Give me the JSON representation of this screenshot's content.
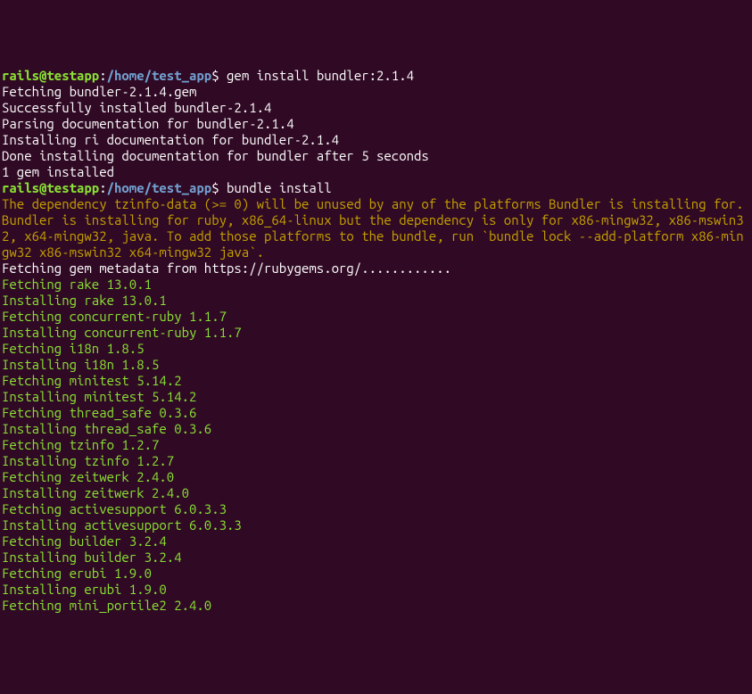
{
  "prompt1": {
    "user": "rails@testapp",
    "colon": ":",
    "path": "/home/test_app",
    "symbol": "$ ",
    "command": "gem install bundler:2.1.4"
  },
  "output1": {
    "line1": "Fetching bundler-2.1.4.gem",
    "line2": "Successfully installed bundler-2.1.4",
    "line3": "Parsing documentation for bundler-2.1.4",
    "line4": "Installing ri documentation for bundler-2.1.4",
    "line5": "Done installing documentation for bundler after 5 seconds",
    "line6": "1 gem installed"
  },
  "prompt2": {
    "user": "rails@testapp",
    "colon": ":",
    "path": "/home/test_app",
    "symbol": "$ ",
    "command": "bundle install"
  },
  "warning": "The dependency tzinfo-data (>= 0) will be unused by any of the platforms Bundler is installing for. Bundler is installing for ruby, x86_64-linux but the dependency is only for x86-mingw32, x86-mswin32, x64-mingw32, java. To add those platforms to the bundle, run `bundle lock --add-platform x86-mingw32 x86-mswin32 x64-mingw32 java`.",
  "fetch_metadata": "Fetching gem metadata from https://rubygems.org/............",
  "gems": {
    "line1": "Fetching rake 13.0.1",
    "line2": "Installing rake 13.0.1",
    "line3": "Fetching concurrent-ruby 1.1.7",
    "line4": "Installing concurrent-ruby 1.1.7",
    "line5": "Fetching i18n 1.8.5",
    "line6": "Installing i18n 1.8.5",
    "line7": "Fetching minitest 5.14.2",
    "line8": "Installing minitest 5.14.2",
    "line9": "Fetching thread_safe 0.3.6",
    "line10": "Installing thread_safe 0.3.6",
    "line11": "Fetching tzinfo 1.2.7",
    "line12": "Installing tzinfo 1.2.7",
    "line13": "Fetching zeitwerk 2.4.0",
    "line14": "Installing zeitwerk 2.4.0",
    "line15": "Fetching activesupport 6.0.3.3",
    "line16": "Installing activesupport 6.0.3.3",
    "line17": "Fetching builder 3.2.4",
    "line18": "Installing builder 3.2.4",
    "line19": "Fetching erubi 1.9.0",
    "line20": "Installing erubi 1.9.0",
    "line21": "Fetching mini_portile2 2.4.0"
  }
}
